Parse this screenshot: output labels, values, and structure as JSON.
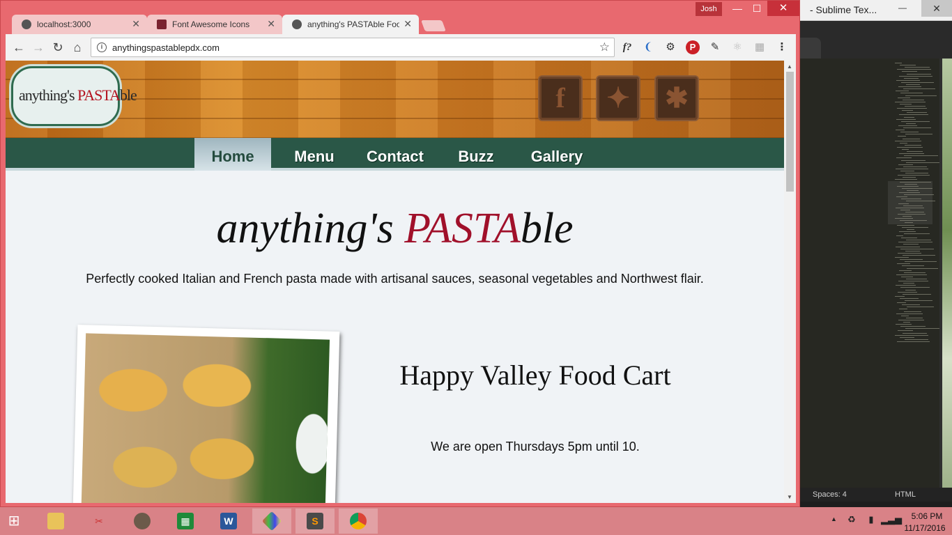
{
  "browser": {
    "tabs": [
      {
        "title": "localhost:3000"
      },
      {
        "title": "Font Awesome Icons"
      },
      {
        "title": "anything's PASTAble Foo"
      }
    ],
    "profile_name": "Josh",
    "url": "anythingspastablepdx.com",
    "extensions": [
      "font-finder-icon",
      "web-developer-icon",
      "gear-icon",
      "pinterest-icon",
      "eyedropper-icon",
      "react-icon",
      "extension-icon",
      "menu-icon"
    ],
    "extension_labels": {
      "font_finder": "f?"
    }
  },
  "site": {
    "logo": {
      "prefix": "anything's ",
      "highlight": "PASTA",
      "suffix": "ble"
    },
    "social": [
      "facebook-icon",
      "twitter-icon",
      "yelp-icon"
    ],
    "social_glyphs": {
      "facebook": "f",
      "twitter": "✦",
      "yelp": "✱"
    },
    "nav": [
      "Home",
      "Menu",
      "Contact",
      "Buzz",
      "Gallery"
    ],
    "active_nav": "Home",
    "hero": {
      "prefix": "anything's ",
      "highlight": "PASTA",
      "suffix": "ble"
    },
    "tagline": "Perfectly cooked Italian and French pasta made with artisanal sauces, seasonal vegetables and Northwest flair.",
    "cart_title": "Happy Valley Food Cart",
    "cart_hours": "We are open Thursdays 5pm until 10."
  },
  "sublime": {
    "title": "- Sublime Tex...",
    "status_spaces": "Spaces: 4",
    "status_syntax": "HTML"
  },
  "taskbar": {
    "apps": [
      "file-explorer-icon",
      "snipping-tool-icon",
      "gimp-icon",
      "calculator-icon",
      "word-icon",
      "paint-icon",
      "sublime-text-icon",
      "chrome-icon"
    ],
    "time": "5:06 PM",
    "date": "11/17/2016"
  },
  "colors": {
    "chrome_frame": "#e8696f",
    "nav_green": "#2a5747",
    "accent_red": "#a0102a",
    "taskbar": "#d98287"
  }
}
